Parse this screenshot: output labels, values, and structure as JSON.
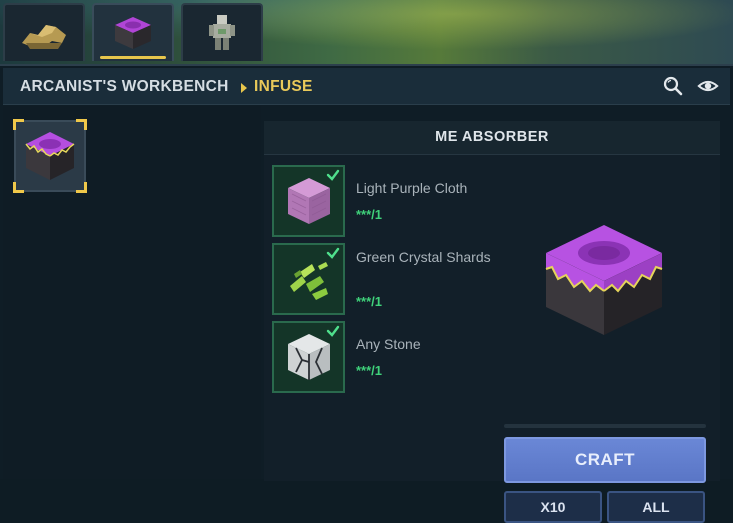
{
  "tabs": [
    {
      "name": "tab-dragon-figure",
      "active": false
    },
    {
      "name": "tab-me-absorber",
      "active": true
    },
    {
      "name": "tab-armor-stand",
      "active": false
    }
  ],
  "header": {
    "breadcrumb_root": "ARCANIST'S WORKBENCH",
    "breadcrumb_current": "INFUSE"
  },
  "recipe": {
    "title": "ME ABSORBER",
    "ingredients": [
      {
        "name": "Light Purple Cloth",
        "count": "***/1",
        "icon": "purple-cloth-icon"
      },
      {
        "name": "Green Crystal Shards",
        "count": "***/1",
        "icon": "green-crystal-icon"
      },
      {
        "name": "Any Stone",
        "count": "***/1",
        "icon": "stone-icon"
      }
    ]
  },
  "buttons": {
    "craft": "CRAFT",
    "x10": "X10",
    "all": "ALL"
  },
  "colors": {
    "accent": "#e7c64c",
    "count_green": "#3fd17a",
    "craft_blue": "#5a76c6"
  }
}
